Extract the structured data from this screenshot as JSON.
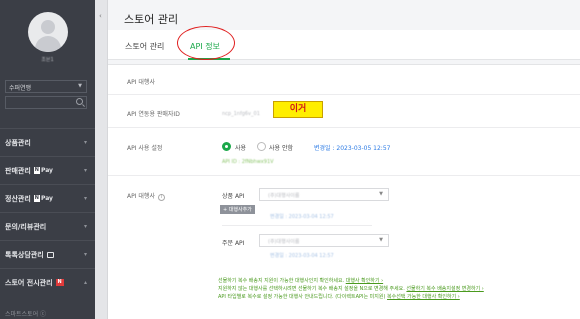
{
  "sidebar": {
    "store_name": "조은1",
    "select_value": "수퍼연맹",
    "items": [
      {
        "label": "상품관리"
      },
      {
        "label": "판매관리",
        "npay": "N",
        "pay": "Pay"
      },
      {
        "label": "정산관리",
        "npay": "N",
        "pay": "Pay"
      },
      {
        "label": "문의/리뷰관리"
      },
      {
        "label": "톡톡상담관리"
      },
      {
        "label": "스토어 전시관리",
        "badge": "N"
      }
    ],
    "bottom_link": "스마트스토어 ⓒ"
  },
  "header": {
    "title": "스토어 관리",
    "tabs": [
      {
        "label": "스토어 관리"
      },
      {
        "label": "API 정보"
      }
    ]
  },
  "content": {
    "api_agency_header": "API 대행사",
    "seller_id_label": "API 연동용 판매자ID",
    "seller_id_value": "ncp_1nfg6v_01",
    "note": "이거",
    "usage_label": "API 사용 설정",
    "use_label": "사용",
    "unused_label": "사용 안함",
    "changed_date": "변경일 : 2023-03-05 12:57",
    "api_id_blurred": "API ID : 2fNbhwx91V",
    "agency_label": "API 대행사",
    "product_api_label": "상품 API",
    "product_api_value": "(주)대행사이름",
    "add_agency_button": "+ 대행사추가",
    "product_changed_blurred": "변경일 : 2023-03-04 12:57",
    "order_api_label": "주문 API",
    "order_api_value": "(주)대행사이름",
    "order_changed_blurred": "변경일 : 2023-03-04 12:57",
    "info_lines": [
      {
        "text": "선물하기 복수 배송지 지원이 가능한 대행사인지 확인하세요. ",
        "link": "대행사 확인하기 ›"
      },
      {
        "text": "지원하지 않는 대행사를 선택하시려면 선물하기 복수 배송지 설정을 N으로 변경해 주세요. ",
        "link": "선물하기 복수 배송지설정 변경하기 ›"
      },
      {
        "text": "API 타입별로 복수로 설정 가능한 대행사 안내드립니다. (다이렉트API는 미지원) ",
        "link": "복수선택 가능한 대행사 확인하기 ›"
      }
    ]
  }
}
